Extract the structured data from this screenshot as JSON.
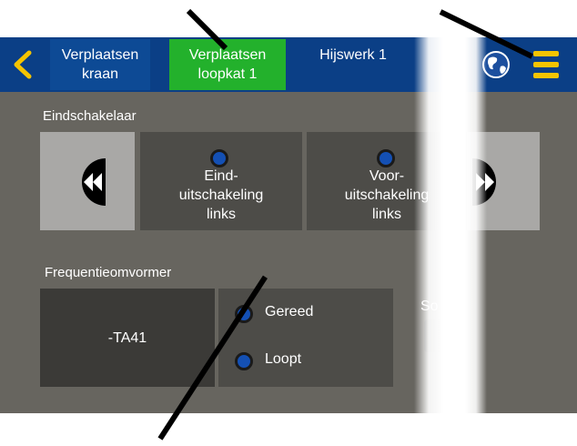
{
  "navbar": {
    "back_icon": "chevron-left-icon",
    "tabs": [
      {
        "label": "Verplaatsen\nkraan"
      },
      {
        "label": "Verplaatsen\nloopkat 1"
      },
      {
        "label": "Hijswerk  1"
      }
    ],
    "globe_icon": "globe-icon",
    "menu_icon": "hamburger-menu-icon"
  },
  "limit_switch": {
    "title": "Eindschakelaar",
    "prev_icon": "double-chevron-left-icon",
    "next_icon": "double-chevron-right-icon",
    "items": [
      {
        "label": "Eind-\nuitschakeling\nlinks"
      },
      {
        "label": "Voor-\nuitschakeling\nlinks"
      }
    ]
  },
  "frequency_converter": {
    "title": "Frequentieomvormer",
    "device": "-TA41",
    "statuses": [
      {
        "label": "Gereed"
      },
      {
        "label": "Loopt"
      }
    ],
    "partial_label": "So"
  },
  "colors": {
    "nav_bg": "#0b3f86",
    "active_tab": "#23b12c",
    "panel_bg": "#67655f",
    "led_blue": "#1450b4",
    "accent_yellow": "#f5c400"
  }
}
